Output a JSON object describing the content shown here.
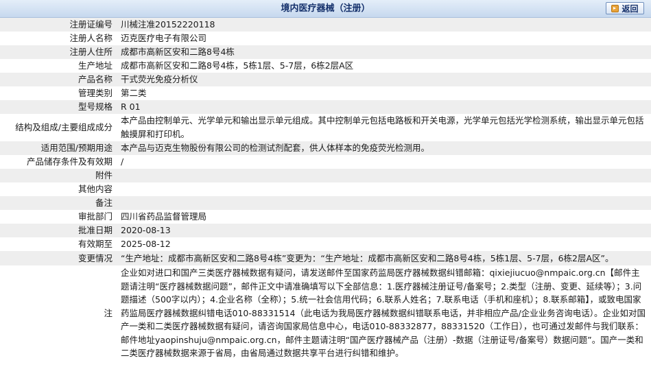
{
  "header": {
    "title": "境内医疗器械（注册）",
    "back_label": "返回"
  },
  "rows": [
    {
      "label": "注册证编号",
      "value": "川械注准20152220118"
    },
    {
      "label": "注册人名称",
      "value": "迈克医疗电子有限公司"
    },
    {
      "label": "注册人住所",
      "value": "成都市高新区安和二路8号4栋"
    },
    {
      "label": "生产地址",
      "value": "成都市高新区安和二路8号4栋，5栋1层、5-7层，6栋2层A区"
    },
    {
      "label": "产品名称",
      "value": "干式荧光免疫分析仪"
    },
    {
      "label": "管理类别",
      "value": "第二类"
    },
    {
      "label": "型号规格",
      "value": "R 01"
    },
    {
      "label": "结构及组成/主要组成成分",
      "value": "本产品由控制单元、光学单元和输出显示单元组成。其中控制单元包括电路板和开关电源，光学单元包括光学检测系统，输出显示单元包括触摸屏和打印机。"
    },
    {
      "label": "适用范围/预期用途",
      "value": "本产品与迈克生物股份有限公司的检测试剂配套，供人体样本的免疫荧光检测用。"
    },
    {
      "label": "产品储存条件及有效期",
      "value": "/"
    },
    {
      "label": "附件",
      "value": ""
    },
    {
      "label": "其他内容",
      "value": ""
    },
    {
      "label": "备注",
      "value": ""
    },
    {
      "label": "审批部门",
      "value": "四川省药品监督管理局"
    },
    {
      "label": "批准日期",
      "value": "2020-08-13"
    },
    {
      "label": "有效期至",
      "value": "2025-08-12"
    },
    {
      "label": "变更情况",
      "value": "“生产地址：成都市高新区安和二路8号4栋”变更为：“生产地址：成都市高新区安和二路8号4栋，5栋1层、5-7层，6栋2层A区”。"
    },
    {
      "label": "注",
      "value": "企业如对进口和国产三类医疗器械数据有疑问，请发送邮件至国家药监局医疗器械数据纠错邮箱：qixiejiucuo@nmpaic.org.cn【邮件主题请注明“医疗器械数据问题”，邮件正文中请准确填写以下全部信息：1.医疗器械注册证号/备案号；2.类型（注册、变更、延续等）；3.问题描述（500字以内）；4.企业名称（全称）；5.统一社会信用代码；6.联系人姓名；7.联系电话（手机和座机）；8.联系邮箱】，或致电国家药监局医疗器械数据纠错电话010-88331514（此电话为我局医疗器械数据纠错联系电话，并非相应产品/企业业务咨询电话）。企业如对国产一类和二类医疗器械数据有疑问，请咨询国家局信息中心，电话010-88332877，88331520（工作日），也可通过发邮件与我们联系：邮件地址yaopinshuju@nmpaic.org.cn，邮件主题请注明“国产医疗器械产品（注册）-数据（注册证号/备案号）数据问题”。国产一类和二类医疗器械数据来源于省局，由省局通过数据共享平台进行纠错和维护。"
    }
  ]
}
